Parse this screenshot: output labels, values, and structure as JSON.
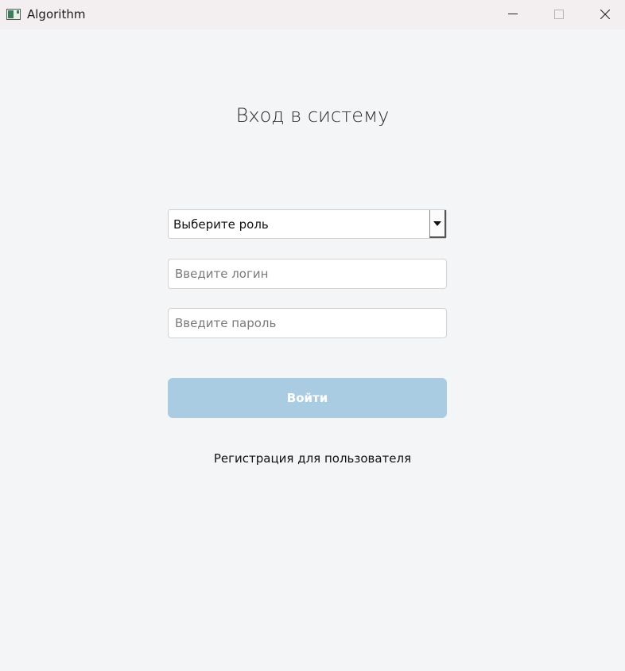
{
  "window": {
    "title": "Algorithm"
  },
  "form": {
    "heading": "Вход в систему",
    "role_select": {
      "selected": "Выберите роль"
    },
    "login": {
      "placeholder": "Введите логин",
      "value": ""
    },
    "password": {
      "placeholder": "Введите пароль",
      "value": ""
    },
    "submit_label": "Войти",
    "register_link": "Регистрация для пользователя"
  },
  "icons": {
    "app": "app-window-icon",
    "minimize": "minimize-icon",
    "maximize": "maximize-icon",
    "close": "close-icon",
    "dropdown": "caret-down-icon"
  },
  "colors": {
    "background": "#f4f5f7",
    "titlebar": "#f3eff1",
    "submit_button": "#aacce2",
    "submit_text": "#ffffff"
  }
}
